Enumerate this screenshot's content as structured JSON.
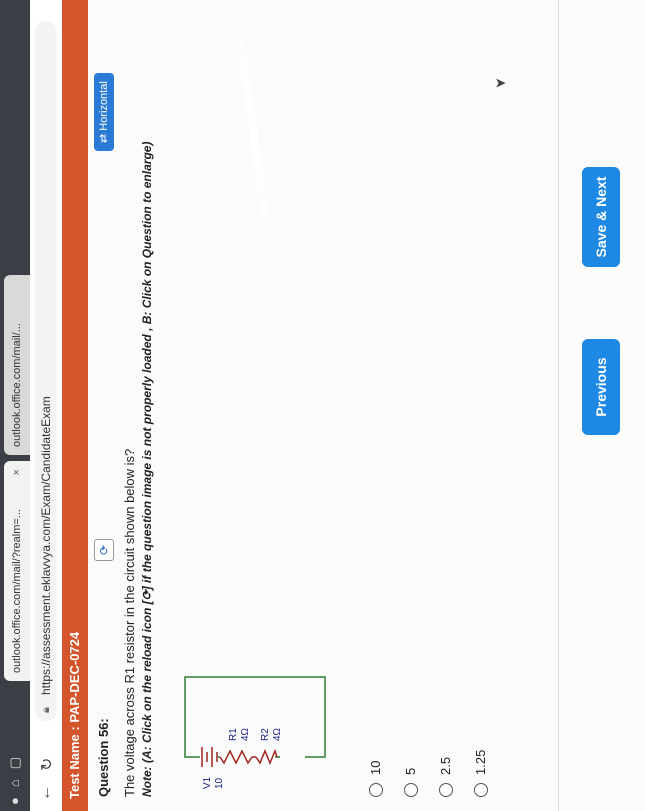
{
  "browser": {
    "tab1_title": "outlook.office.com/mail/?realm=...",
    "tab2_title": "outlook.office.com/mail/...",
    "tab_close": "×",
    "url": "https://assessment.eklavvya.com/Exam/CandidateExam"
  },
  "header": {
    "test_name": "Test Name : PAP-DEC-0724"
  },
  "question": {
    "title": "Question 56:",
    "reload_icon": "⟳",
    "toggle_label": "⇄ Horizontal",
    "text": "The voltage across R1 resistor in the circuit shown below is?",
    "note": "Note: (A: Click on the reload icon [⟳] if the question image is not properly loaded , B: Click on Question to enlarge)"
  },
  "circuit": {
    "source_name": "V1",
    "source_value": "10",
    "r1_name": "R1",
    "r1_value": "4Ω",
    "r2_name": "R2",
    "r2_value": "4Ω"
  },
  "options": [
    "10",
    "5",
    "2.5",
    "1.25"
  ],
  "buttons": {
    "previous": "Previous",
    "save_next": "Save & Next"
  },
  "colors": {
    "header_bar": "#d4552c",
    "button": "#1e88e5",
    "wire": "#2e7d32"
  }
}
